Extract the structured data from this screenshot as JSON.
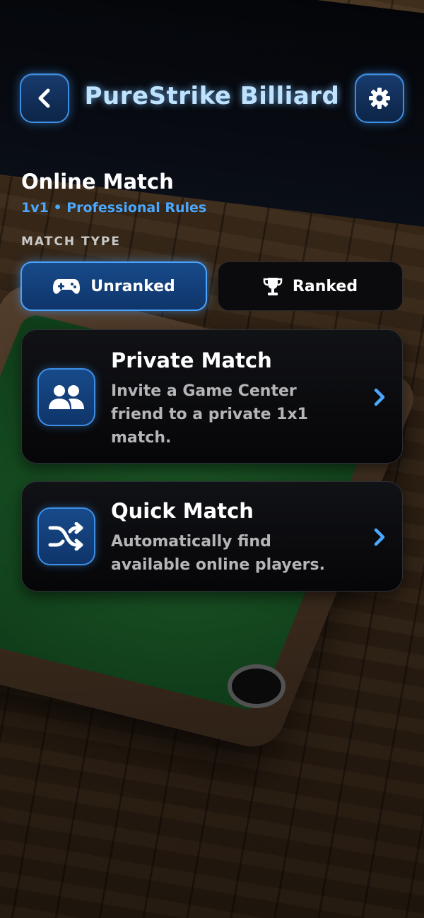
{
  "header": {
    "title": "PureStrike Billiard",
    "back_icon": "chevron-left-icon",
    "settings_icon": "gear-icon"
  },
  "section": {
    "title": "Online Match",
    "subtitle": "1v1 • Professional Rules"
  },
  "match_type": {
    "label": "MATCH TYPE",
    "options": [
      {
        "label": "Unranked",
        "icon": "gamepad-icon",
        "selected": true
      },
      {
        "label": "Ranked",
        "icon": "trophy-icon",
        "selected": false
      }
    ]
  },
  "cards": [
    {
      "title": "Private Match",
      "description": "Invite a Game Center friend to a private 1x1 match.",
      "icon": "people-icon"
    },
    {
      "title": "Quick Match",
      "description": "Automatically find available online players.",
      "icon": "shuffle-icon"
    }
  ],
  "colors": {
    "accent": "#3d8fe6",
    "subtitle_blue": "#4aa8ff",
    "title_glow": "#bfe3ff",
    "card_bg": "#0b0b0d"
  }
}
